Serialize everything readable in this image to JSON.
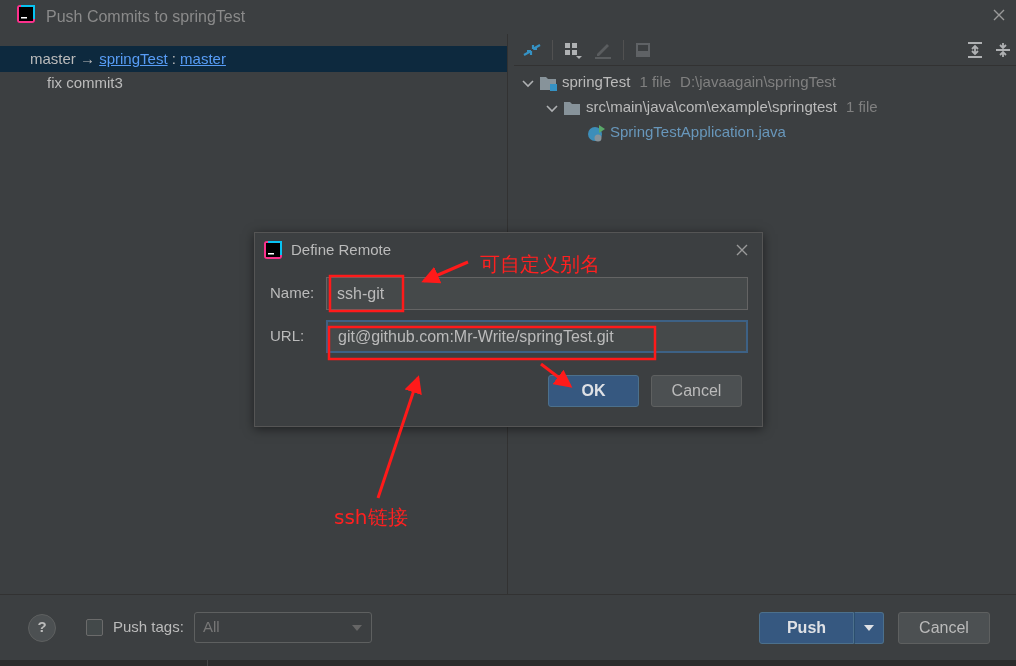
{
  "window": {
    "title": "Push Commits to springTest"
  },
  "commits_tree": {
    "branch": {
      "source": "master",
      "arrow": "→",
      "remote": "springTest",
      "separator": ":",
      "target": "master",
      "selected": true
    },
    "commits": [
      {
        "message": "fix commit3"
      }
    ]
  },
  "changes_tree": [
    {
      "name": "springTest",
      "count": "1 file",
      "path": "D:\\javaagain\\springTest",
      "expanded": true,
      "children": [
        {
          "name": "src\\main\\java\\com\\example\\springtest",
          "count": "1 file",
          "expanded": true,
          "children": [
            {
              "name": "SpringTestApplication.java"
            }
          ]
        }
      ]
    }
  ],
  "dialog": {
    "title": "Define Remote",
    "fields": [
      {
        "label": "Name:",
        "value": "ssh-git",
        "focused": false
      },
      {
        "label": "URL:",
        "value": "git@github.com:Mr-Write/springTest.git",
        "focused": true
      }
    ],
    "buttons": [
      {
        "label": "OK",
        "kind": "primary"
      },
      {
        "label": "Cancel",
        "kind": "secondary"
      }
    ]
  },
  "annotations": [
    {
      "text": "可自定义别名"
    },
    {
      "text": "ssh链接"
    }
  ],
  "footer": {
    "help": "?",
    "push_tags": {
      "label": "Push tags:",
      "checked": false
    },
    "tags_select": {
      "value": "All",
      "disabled": true
    },
    "buttons": [
      {
        "label": "Push",
        "kind": "primary"
      },
      {
        "label": "Cancel",
        "kind": "secondary"
      }
    ]
  }
}
